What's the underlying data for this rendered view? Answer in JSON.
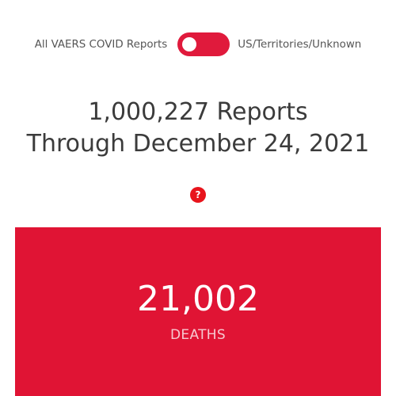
{
  "toggle": {
    "left_label": "All VAERS COVID Reports",
    "right_label": "US/Territories/Unknown",
    "state": "left",
    "color": "#e01a3c"
  },
  "headline": {
    "line1": "1,000,227 Reports",
    "line2": "Through December 24, 2021"
  },
  "help": {
    "icon": "question-circle-icon",
    "glyph": "?",
    "color": "#e8141c"
  },
  "stat": {
    "value": "21,002",
    "label": "DEATHS",
    "panel_color": "#e01434"
  }
}
